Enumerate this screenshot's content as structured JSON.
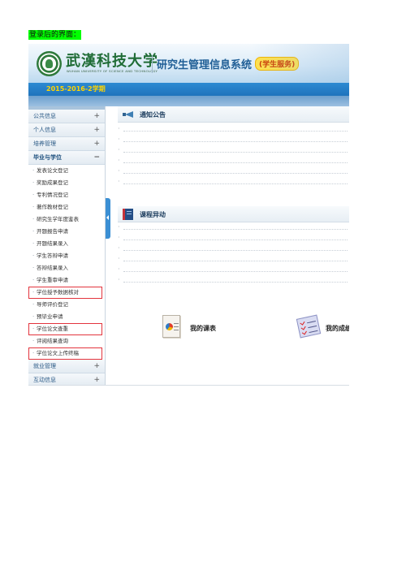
{
  "caption": "登录后的界面：",
  "header": {
    "university_name": "武漢科技大学",
    "university_en": "WUHAN UNIVERSITY OF SCIENCE AND TECHNOLOGY",
    "system_title": "研究生管理信息系统",
    "badge": "(学生服务)"
  },
  "term": "2015-2016-2学期",
  "sidebar": {
    "groups": [
      {
        "label": "公共信息",
        "sign": "+"
      },
      {
        "label": "个人信息",
        "sign": "+"
      },
      {
        "label": "培养管理",
        "sign": "+"
      },
      {
        "label": "毕业与学位",
        "sign": "−"
      }
    ],
    "items": [
      {
        "label": "发表论文登记"
      },
      {
        "label": "奖励成果登记"
      },
      {
        "label": "专利情况登记"
      },
      {
        "label": "著作教材登记"
      },
      {
        "label": "研究生学年度鉴表"
      },
      {
        "label": "开题报告申请"
      },
      {
        "label": "开题结果录入"
      },
      {
        "label": "学生答辩申请"
      },
      {
        "label": "答辩结果录入"
      },
      {
        "label": "学生重审申请"
      },
      {
        "label": "学位授予数据核对"
      },
      {
        "label": "导师评价登记"
      },
      {
        "label": "预毕业申请"
      },
      {
        "label": "学位论文查重"
      },
      {
        "label": "评阅结果查询"
      },
      {
        "label": "学位论文上传终稿"
      }
    ],
    "bottom_groups": [
      {
        "label": "就业管理",
        "sign": "+"
      },
      {
        "label": "互动信息",
        "sign": "+"
      }
    ]
  },
  "main": {
    "notice_title": "通知公告",
    "course_change_title": "课程异动",
    "quick_links": [
      {
        "label": "我的课表"
      },
      {
        "label": "我的成绩"
      }
    ]
  },
  "colors": {
    "caption_highlight": "#00ff00",
    "term_bar": "#1f73bc",
    "term_text": "#ffd400",
    "badge_bg": "#ffe14d",
    "highlight_border": "#e3343d"
  }
}
